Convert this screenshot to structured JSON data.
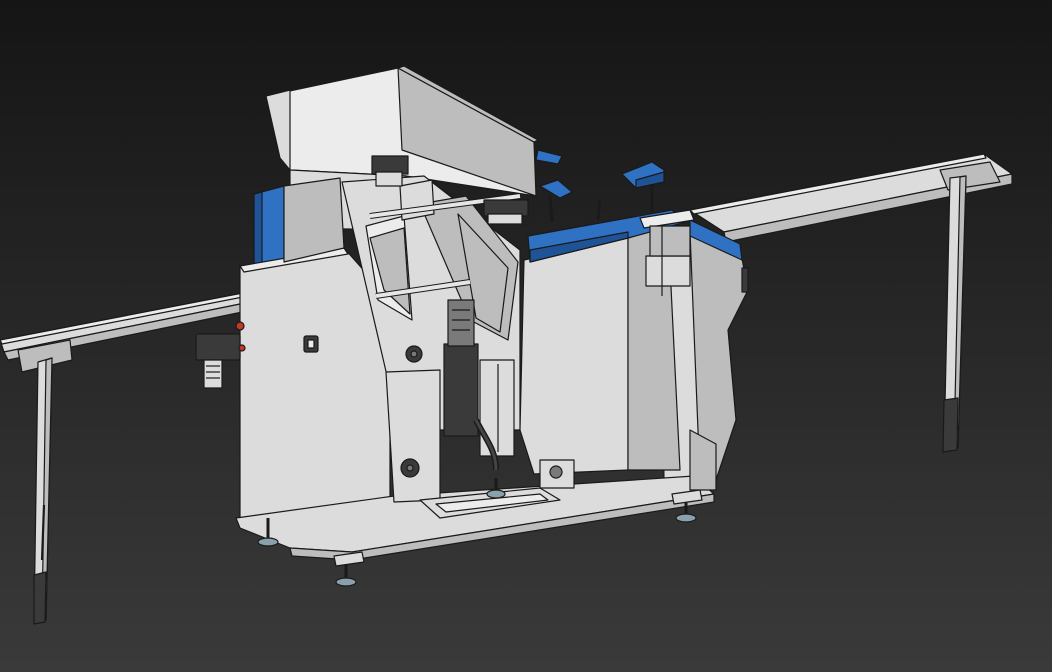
{
  "scene": {
    "subject": "machine-cad-render",
    "colors": {
      "background_top": "#151515",
      "background_bottom": "#3a3a3a",
      "body": "#dcdcdc",
      "body_shade": "#bdbdbd",
      "body_light": "#ececec",
      "accent_blue": "#2f72c4",
      "accent_blue_dark": "#1f5398",
      "outline": "#1a1a1a",
      "metal_dark": "#3a3a3a",
      "foot": "#8aa0ad"
    }
  }
}
